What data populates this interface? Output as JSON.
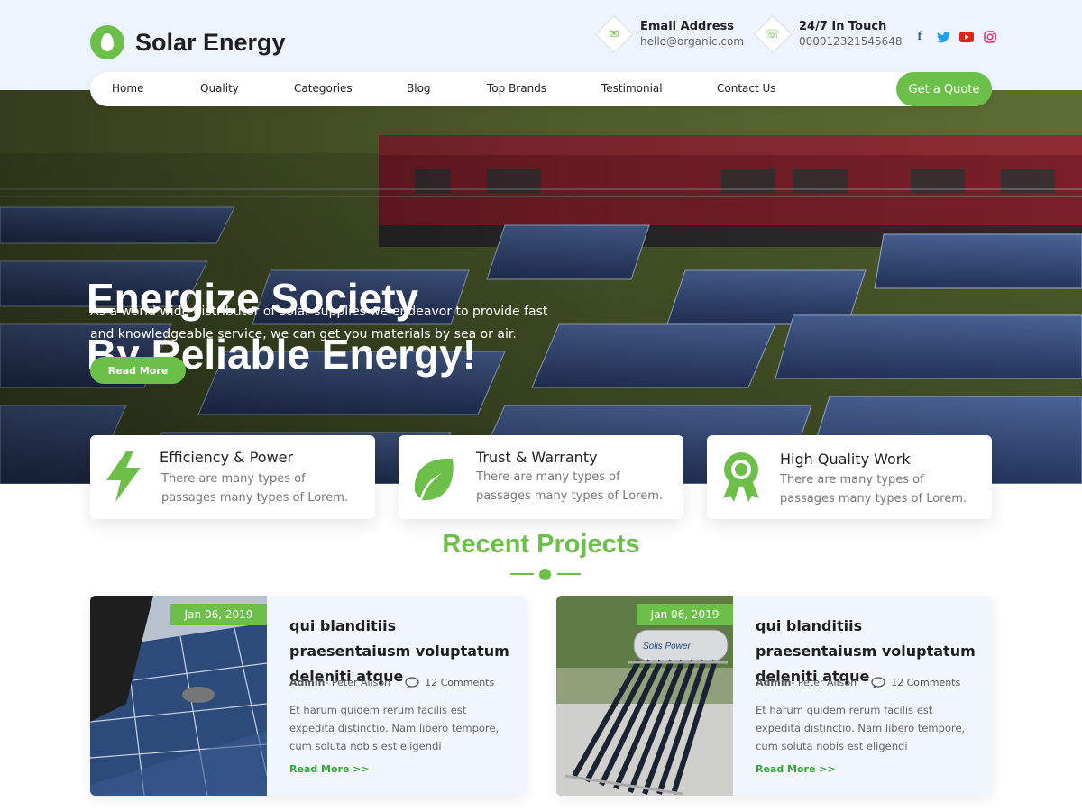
{
  "brand": {
    "name": "Solar Energy",
    "accent": "#6cc04a"
  },
  "contacts": [
    {
      "label": "Email Address",
      "value": "hello@organic.com",
      "icon": "mail-icon"
    },
    {
      "label": "24/7 In Touch",
      "value": "000012321545648",
      "icon": "phone-icon"
    }
  ],
  "social": [
    {
      "name": "facebook-icon",
      "glyph": "f",
      "color": "#3b5998"
    },
    {
      "name": "twitter-icon",
      "glyph": "t",
      "color": "#1da1f2"
    },
    {
      "name": "youtube-icon",
      "glyph": "▶",
      "color": "#e62117"
    },
    {
      "name": "instagram-icon",
      "glyph": "◎",
      "color": "#e1306c"
    }
  ],
  "nav": {
    "items": [
      "Home",
      "Quality",
      "Categories",
      "Blog",
      "Top Brands",
      "Testimonial",
      "Contact Us"
    ],
    "cta": "Get a Quote"
  },
  "hero": {
    "title_line1": "Energize Society",
    "title_line2": "By Reliable Energy!",
    "description": "As a world wide distributor of solar supplies we endeavor to provide fast and knowledgeable service, we can get you materials by sea or air.",
    "button": "Read More"
  },
  "features": [
    {
      "title": "Efficiency & Power",
      "desc": "There are many types of passages many types of Lorem.",
      "icon": "lightning-icon"
    },
    {
      "title": "Trust & Warranty",
      "desc": "There are many types of passages many types of Lorem.",
      "icon": "leaf-icon"
    },
    {
      "title": "High Quality Work",
      "desc": "There are many types of passages many types of Lorem.",
      "icon": "award-ribbon-icon"
    }
  ],
  "projects": {
    "title": "Recent Projects",
    "items": [
      {
        "date": "Jan 06, 2019",
        "title": "qui blanditiis praesentaiusm voluptatum deleniti atque",
        "author": "Admin",
        "author_rest": " - Peter Alison",
        "comments": "12 Comments",
        "desc": "Et harum quidem rerum facilis est expedita distinctio. Nam libero tempore, cum soluta nobis est eligendi",
        "more": "Read More >>",
        "image": "solar-panel-installation-photo"
      },
      {
        "date": "Jan 06, 2019",
        "title": "qui blanditiis praesentaiusm voluptatum deleniti atque",
        "author": "Admin",
        "author_rest": " - Peter Alison",
        "comments": "12 Comments",
        "desc": "Et harum quidem rerum facilis est expedita distinctio. Nam libero tempore, cum soluta nobis est eligendi",
        "more": "Read More >>",
        "image": "solar-water-heater-photo"
      }
    ],
    "image_brand_text": "Solis Power"
  }
}
